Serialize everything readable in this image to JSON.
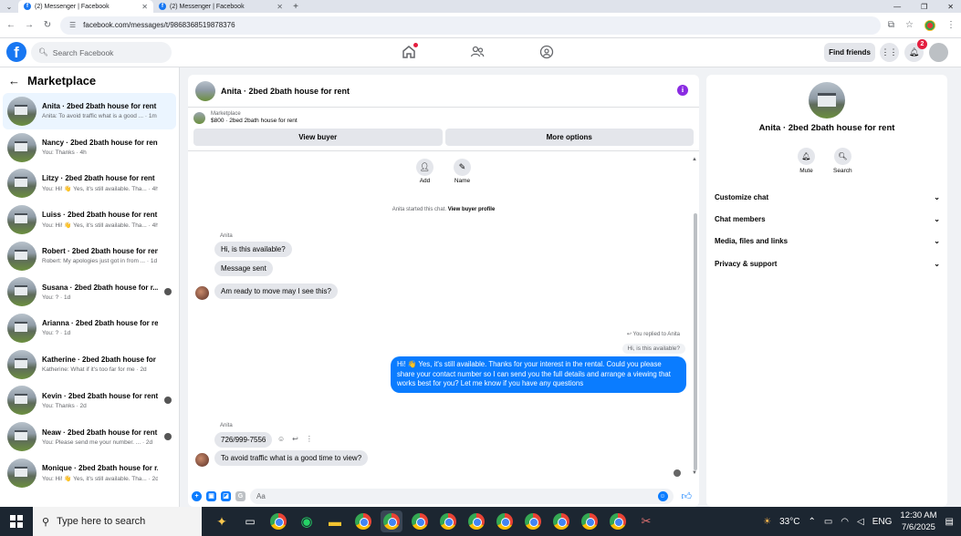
{
  "browser": {
    "tabs": [
      {
        "label": "(2) Messenger | Facebook",
        "active": true
      },
      {
        "label": "(2) Messenger | Facebook",
        "active": false
      }
    ],
    "url": "facebook.com/messages/t/9868368519878376"
  },
  "fb_nav": {
    "search_placeholder": "Search Facebook",
    "find_friends": "Find friends",
    "notifications_count": "2"
  },
  "sidebar": {
    "title": "Marketplace",
    "conversations": [
      {
        "title": "Anita · 2bed 2bath house for rent",
        "preview": "Anita: To avoid traffic what is a good ... · 1m",
        "active": true
      },
      {
        "title": "Nancy · 2bed 2bath house for rent",
        "preview": "You: Thanks · 4h"
      },
      {
        "title": "Litzy · 2bed 2bath house for rent",
        "preview": "You: Hi! 👋 Yes, it's still available. Tha... · 4h"
      },
      {
        "title": "Luiss · 2bed 2bath house for rent",
        "preview": "You: Hi! 👋 Yes, it's still available. Tha... · 4h"
      },
      {
        "title": "Robert · 2bed 2bath house for rent",
        "preview": "Robert: My apologies just got in from ... · 1d"
      },
      {
        "title": "Susana · 2bed 2bath house for r...",
        "preview": "You: ? · 1d"
      },
      {
        "title": "Arianna · 2bed 2bath house for rent",
        "preview": "You: ? · 1d"
      },
      {
        "title": "Katherine · 2bed 2bath house for r...",
        "preview": "Katherine: What if it's too far for me · 2d"
      },
      {
        "title": "Kevin · 2bed 2bath house for rent",
        "preview": "You: Thanks · 2d"
      },
      {
        "title": "Neaw · 2bed 2bath house for rent",
        "preview": "You: Please send me your number. ... · 2d"
      },
      {
        "title": "Monique · 2bed 2bath house for r...",
        "preview": "You: Hi! 👋 Yes, it's still available. Tha... · 2d"
      }
    ]
  },
  "chat": {
    "title": "Anita · 2bed 2bath house for rent",
    "listing_label": "Marketplace",
    "listing_detail": "$800 · 2bed 2bath house for rent",
    "view_buyer": "View buyer",
    "more_options": "More options",
    "action_add": "Add",
    "action_name": "Name",
    "system_prefix": "Anita started this chat.",
    "system_link": "View buyer profile",
    "sender_name": "Anita",
    "msg1": "Hi, is this available?",
    "msg2": "Message sent",
    "msg3": "Am ready to move may I see this?",
    "replied_label": "You replied to Anita",
    "quoted": "Hi, is this available?",
    "outgoing": "Hi! 👋 Yes, it's still available. Thanks for your interest in the rental. Could you please share your contact number so I can send you the full details and arrange a viewing that works best for you? Let me know if you have any questions",
    "msg4": "726/999-7556",
    "msg5": "To avoid traffic what is a good time to view?",
    "composer_placeholder": "Aa"
  },
  "right_panel": {
    "title": "Anita · 2bed 2bath house for rent",
    "mute": "Mute",
    "search": "Search",
    "menu": [
      "Customize chat",
      "Chat members",
      "Media, files and links",
      "Privacy & support"
    ]
  },
  "taskbar": {
    "search_placeholder": "Type here to search",
    "temperature": "33°C",
    "language": "ENG",
    "time": "12:30 AM",
    "date": "7/6/2025"
  }
}
